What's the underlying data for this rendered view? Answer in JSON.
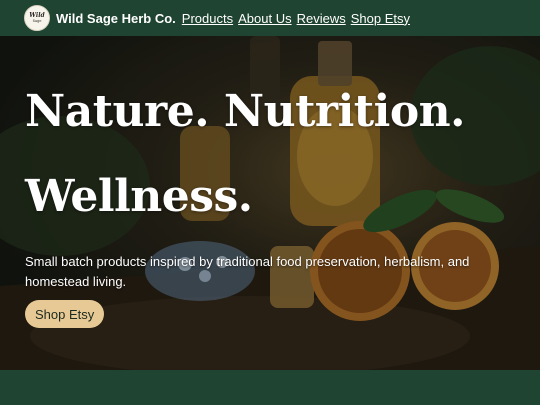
{
  "header": {
    "brand": "Wild Sage Herb Co.",
    "logo_text": "Wild",
    "logo_sub": "Sage",
    "nav": [
      "Products",
      "About Us",
      "Reviews",
      "Shop Etsy"
    ]
  },
  "hero": {
    "headline_line1": "Nature. Nutrition.",
    "headline_line2": "Wellness.",
    "tagline": "Small batch products inspired by traditional food preservation, herbalism, and homestead living.",
    "cta_label": "Shop Etsy"
  },
  "colors": {
    "brand_green": "#1f4431",
    "cta_bg": "#e7c995"
  }
}
